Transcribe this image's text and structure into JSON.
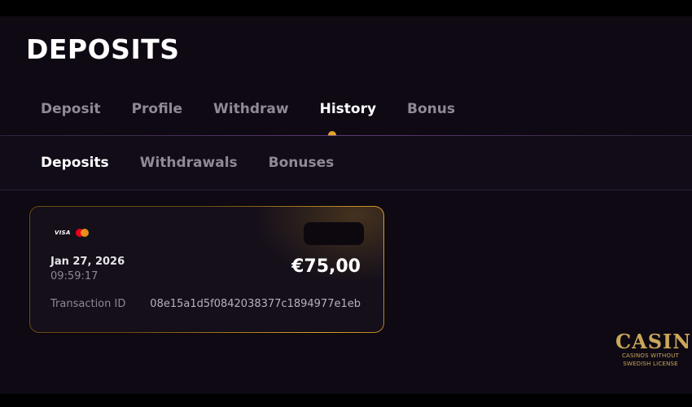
{
  "page": {
    "title": "DEPOSITS"
  },
  "tabs": [
    {
      "label": "Deposit",
      "active": false
    },
    {
      "label": "Profile",
      "active": false
    },
    {
      "label": "Withdraw",
      "active": false
    },
    {
      "label": "History",
      "active": true
    },
    {
      "label": "Bonus",
      "active": false
    }
  ],
  "subtabs": [
    {
      "label": "Deposits",
      "active": true
    },
    {
      "label": "Withdrawals",
      "active": false
    },
    {
      "label": "Bonuses",
      "active": false
    }
  ],
  "transaction": {
    "payment_icons": {
      "visa_text": "VISA",
      "visa": "visa-icon",
      "mastercard": "mastercard-icon"
    },
    "date": "Jan 27, 2026",
    "time": "09:59:17",
    "amount": "€75,00",
    "id_label": "Transaction ID",
    "id_value": "08e15a1d5f0842038377c1894977e1eb"
  },
  "watermark": {
    "line1": "CASINOS",
    "line2": "CASINOS WITHOUT",
    "line3": "SWEDISH LICENSE"
  },
  "colors": {
    "background": "#0e0912",
    "accent": "#e2a52a",
    "inactive_text": "#8f8a96",
    "card_border": "#6e4d16"
  }
}
